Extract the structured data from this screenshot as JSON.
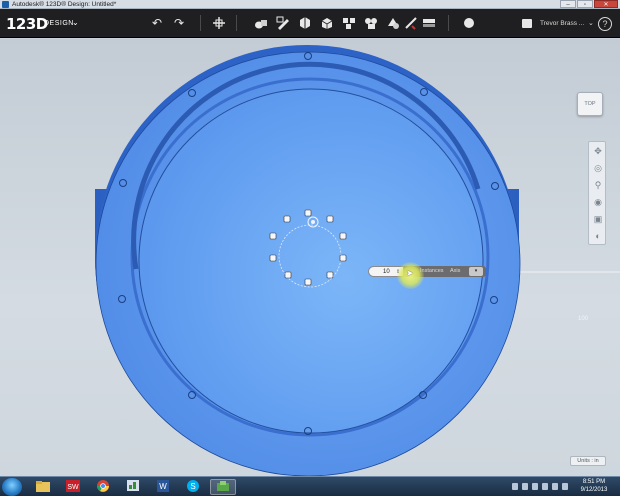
{
  "window": {
    "title": "Autodesk® 123D® Design: Untitled*",
    "buttons": [
      "–",
      "▫",
      "✕"
    ]
  },
  "app": {
    "logo": "123D",
    "logo_sub": "DESIGN",
    "logo_chevron": "⌄"
  },
  "toolbar": {
    "icons": [
      "undo-icon",
      "redo-icon",
      "transform-icon",
      "primitives-icon",
      "sketch-icon",
      "construct-icon",
      "modify-icon",
      "pattern-icon",
      "grouping-icon",
      "combine-icon",
      "measure-icon",
      "text-icon",
      "snap-icon",
      "material-icon"
    ],
    "undo": "↶",
    "redo": "↷"
  },
  "user": {
    "name": "Trevor Brass ...",
    "chevron": "⌄",
    "help": "?"
  },
  "viewcube": {
    "face_label": "TOP"
  },
  "value_widget": {
    "value": "10",
    "arrows": "⇕",
    "label_instances": "Instances",
    "label_axis": "Axis",
    "dropdown": "▾"
  },
  "units": "Units : in",
  "grid_label": "100",
  "colors": {
    "model_top": "#5e9df0",
    "model_side": "#3366cc",
    "toolbar_bg": "#1f1f21",
    "accent_cursor": "#e6ee7a"
  },
  "taskbar": {
    "apps": [
      "explorer",
      "solidworks",
      "chrome",
      "task-manager",
      "word",
      "skype",
      "123d-design"
    ],
    "clock_time": "8:51 PM",
    "clock_date": "9/12/2013"
  }
}
